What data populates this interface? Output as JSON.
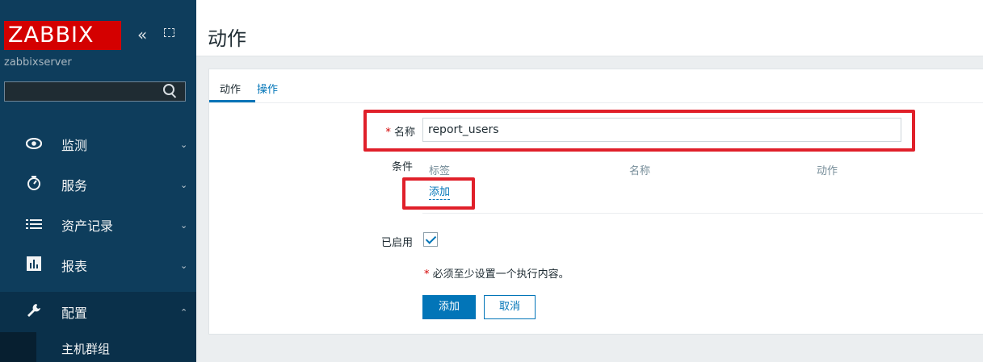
{
  "sidebar": {
    "logo": "ZABBIX",
    "server_name": "zabbixserver",
    "search_placeholder": "",
    "menu": [
      {
        "label": "监测",
        "icon": "eye-icon",
        "expanded": false
      },
      {
        "label": "服务",
        "icon": "clock-icon",
        "expanded": false
      },
      {
        "label": "资产记录",
        "icon": "list-icon",
        "expanded": false
      },
      {
        "label": "报表",
        "icon": "bar-chart-icon",
        "expanded": false
      },
      {
        "label": "配置",
        "icon": "wrench-icon",
        "expanded": true
      }
    ],
    "submenu": [
      {
        "label": "主机群组"
      }
    ]
  },
  "header": {
    "title": "动作"
  },
  "tabs": [
    {
      "label": "动作",
      "active": true
    },
    {
      "label": "操作",
      "active": false
    }
  ],
  "form": {
    "name_label": "名称",
    "name_value": "report_users",
    "required_mark": "*",
    "conditions_label": "条件",
    "conditions_columns": [
      "标签",
      "名称",
      "动作"
    ],
    "conditions_add_link": "添加",
    "enabled_label": "已启用",
    "enabled": true,
    "note": "必须至少设置一个执行内容。",
    "add_button": "添加",
    "cancel_button": "取消"
  },
  "colors": {
    "sidebar_bg": "#0e3d5c",
    "logo_bg": "#d40000",
    "accent": "#0275b8",
    "annotation_red": "#e0202a"
  }
}
